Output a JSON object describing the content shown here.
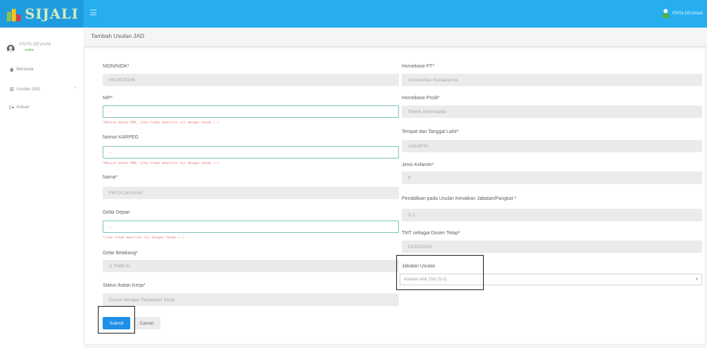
{
  "app": {
    "brand": "SIJALI"
  },
  "top_user": {
    "name": "FRITA DEVIANA"
  },
  "sidebar": {
    "user_name": "FRITA DEVIANI",
    "user_status": "online",
    "items": [
      {
        "label": "Beranda",
        "icon": "home-icon"
      },
      {
        "label": "Usulan JAD",
        "icon": "list-icon"
      },
      {
        "label": "Keluar",
        "icon": "logout-icon"
      }
    ]
  },
  "page": {
    "title": "Tambah Usulan JAD"
  },
  "form": {
    "nidn": {
      "label": "NIDN/NIDK*",
      "value": "0013078206"
    },
    "nip": {
      "label": "NIP*",
      "value": "-",
      "helper": "*Khusus dosen PNS, jika tidak memiliki isi dengan tanda (-)"
    },
    "karpeg": {
      "label": "Nomor KARPEG",
      "value": "-",
      "helper": "*Khusus dosen PNS, jika tidak memiliki isi dengan tanda (-)"
    },
    "nama": {
      "label": "Nama*",
      "value": "FRITA DEVIANI"
    },
    "gelar_depan": {
      "label": "Gelar Depan",
      "value": "-",
      "helper": "*jika tidak memiliki isi dengan tanda (-)"
    },
    "gelar_belakang": {
      "label": "Gelar Belakang*",
      "value": "S.TMM.SI"
    },
    "status_kerja": {
      "label": "Status Ikatan Kerja*",
      "value": "Dosen dengan Perjanjian Kerja"
    },
    "homebase_pt": {
      "label": "Homebase PT*",
      "value": "Universitas Gunadarma"
    },
    "homebase_prodi": {
      "label": "Homebase Prodi*",
      "value": "Teknik Informatika"
    },
    "ttl": {
      "label": "Tempat dan Tanggal Lahir*",
      "value": "JAKARTA"
    },
    "jenis_kelamin": {
      "label": "Jenis Kelamin*",
      "value": "P"
    },
    "pendidikan": {
      "label": "Pendidikan pada Usulan Kenaikan Jabatan/Pangkat *",
      "value": "S-2"
    },
    "tmt": {
      "label": "TMT sebagai Dosen Tetap*",
      "value": "01/10/2016"
    },
    "jabatan": {
      "label": "Jabatan Usulan",
      "value": "Asisten Ahli 150 (S-2)"
    }
  },
  "buttons": {
    "submit": "Submit",
    "cancel": "Cancel"
  }
}
